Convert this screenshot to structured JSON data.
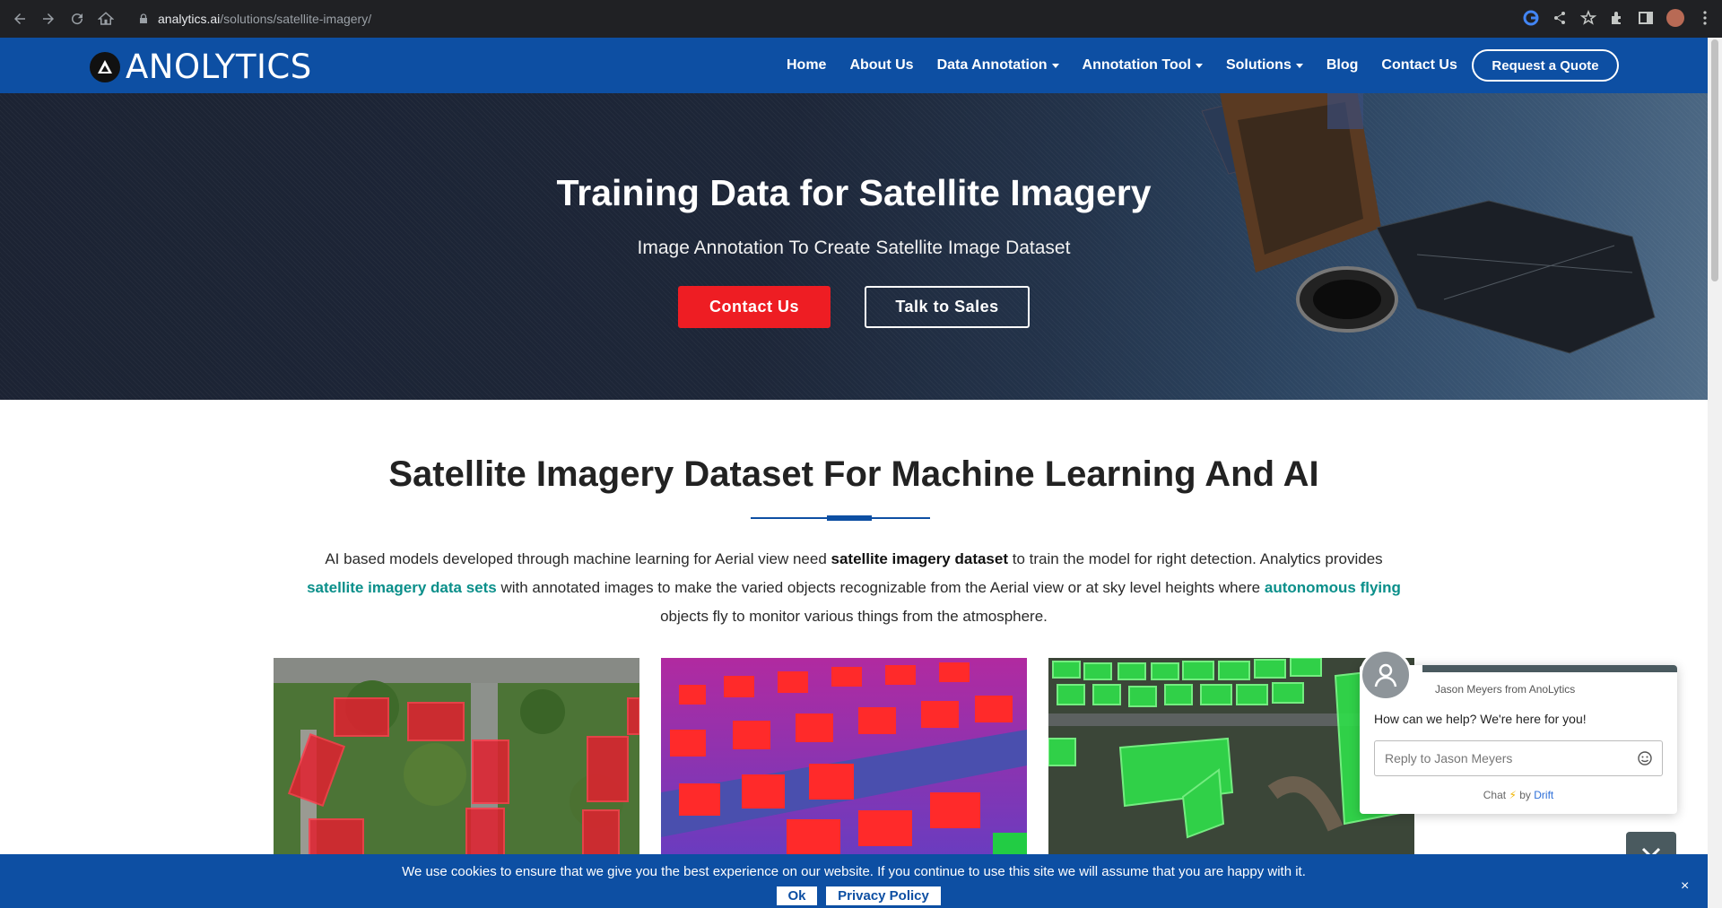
{
  "browser": {
    "url_domain": "analytics.ai",
    "url_path": "/solutions/satellite-imagery/"
  },
  "header": {
    "logo_text": "ANOLYTICS",
    "nav": {
      "home": "Home",
      "about": "About Us",
      "data_annotation": "Data Annotation",
      "annotation_tool": "Annotation Tool",
      "solutions": "Solutions",
      "blog": "Blog",
      "contact": "Contact Us"
    },
    "quote_button": "Request a Quote"
  },
  "hero": {
    "title": "Training Data for Satellite Imagery",
    "subtitle": "Image Annotation To Create Satellite Image Dataset",
    "contact_button": "Contact Us",
    "sales_button": "Talk to Sales"
  },
  "section": {
    "title": "Satellite Imagery Dataset For Machine Learning And AI",
    "p1": "AI based models developed through machine learning for Aerial view need ",
    "p_bold": "satellite imagery dataset",
    "p2": " to train the model for right detection. Analytics provides ",
    "link1": "satellite imagery data sets",
    "p3": " with annotated images to make the varied objects recognizable from the Aerial view or at sky level heights where ",
    "link2": "autonomous flying",
    "p4": " objects fly to monitor various things from the atmosphere."
  },
  "chat": {
    "from": "Jason Meyers from AnoLytics",
    "message": "How can we help? We're here for you!",
    "placeholder": "Reply to Jason Meyers",
    "footer_chat": "Chat",
    "footer_by": "by",
    "footer_drift": "Drift"
  },
  "cookie": {
    "text": "We use cookies to ensure that we give you the best experience on our website. If you continue to use this site we will assume that you are happy with it.",
    "ok": "Ok",
    "privacy": "Privacy Policy",
    "close": "×"
  },
  "colors": {
    "brand_blue": "#0d4fa3",
    "cta_red": "#ee1d23",
    "link_teal": "#0a8f8a"
  }
}
